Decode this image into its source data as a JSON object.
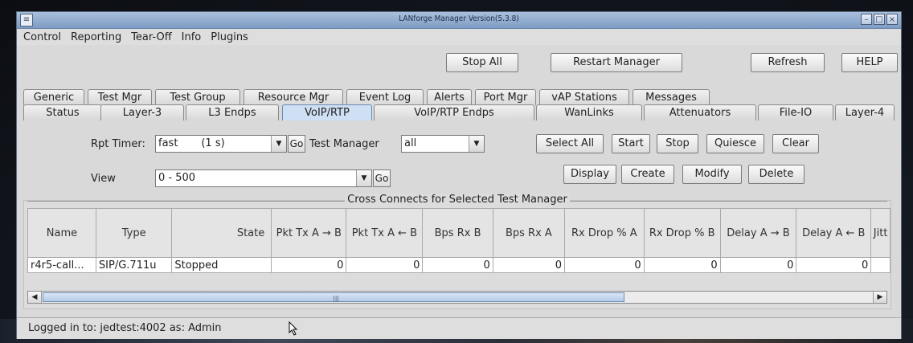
{
  "window": {
    "title": "LANforge Manager   Version(5.3.8)",
    "app_icon": "lanforge-app-icon",
    "controls": [
      "minimize-icon",
      "maximize-icon",
      "close-icon"
    ]
  },
  "menu": [
    "Control",
    "Reporting",
    "Tear-Off",
    "Info",
    "Plugins"
  ],
  "toolbar": {
    "stop_all": "Stop All",
    "restart_manager": "Restart Manager",
    "refresh": "Refresh",
    "help": "HELP"
  },
  "tabs_row1": [
    "Generic",
    "Test Mgr",
    "Test Group",
    "Resource Mgr",
    "Event Log",
    "Alerts",
    "Port Mgr",
    "vAP Stations",
    "Messages"
  ],
  "tabs_row2": [
    "Status",
    "Layer-3",
    "L3 Endps",
    "VoIP/RTP",
    "VoIP/RTP Endps",
    "WanLinks",
    "Attenuators",
    "File-IO",
    "Layer-4"
  ],
  "selected_tab": "VoIP/RTP",
  "controls": {
    "rpt_timer_label": "Rpt Timer:",
    "rpt_timer_value": "fast       (1 s)",
    "go": "Go",
    "test_manager_label": "Test Manager",
    "test_manager_value": "all",
    "view_label": "View",
    "view_value": "0 - 500"
  },
  "actions": {
    "select_all": "Select All",
    "start": "Start",
    "stop": "Stop",
    "quiesce": "Quiesce",
    "clear": "Clear",
    "display": "Display",
    "create": "Create",
    "modify": "Modify",
    "delete": "Delete"
  },
  "group_title": "Cross Connects for Selected Test Manager",
  "table": {
    "columns": [
      "Name",
      "Type",
      "State",
      "Pkt Tx A → B",
      "Pkt Tx A ← B",
      "Bps Rx B",
      "Bps Rx A",
      "Rx Drop % A",
      "Rx Drop % B",
      "Delay A → B",
      "Delay A ← B",
      "Jitt"
    ],
    "rows": [
      [
        "r4r5-call...",
        "SIP/G.711u",
        "Stopped",
        "0",
        "0",
        "0",
        "0",
        "0",
        "0",
        "0",
        "0",
        ""
      ]
    ]
  },
  "scrollbar": {
    "left_arrow": "◀",
    "right_arrow": "▶",
    "grip": "|||"
  },
  "status": {
    "text": "Logged in to:  jedtest:4002  as:  Admin"
  }
}
